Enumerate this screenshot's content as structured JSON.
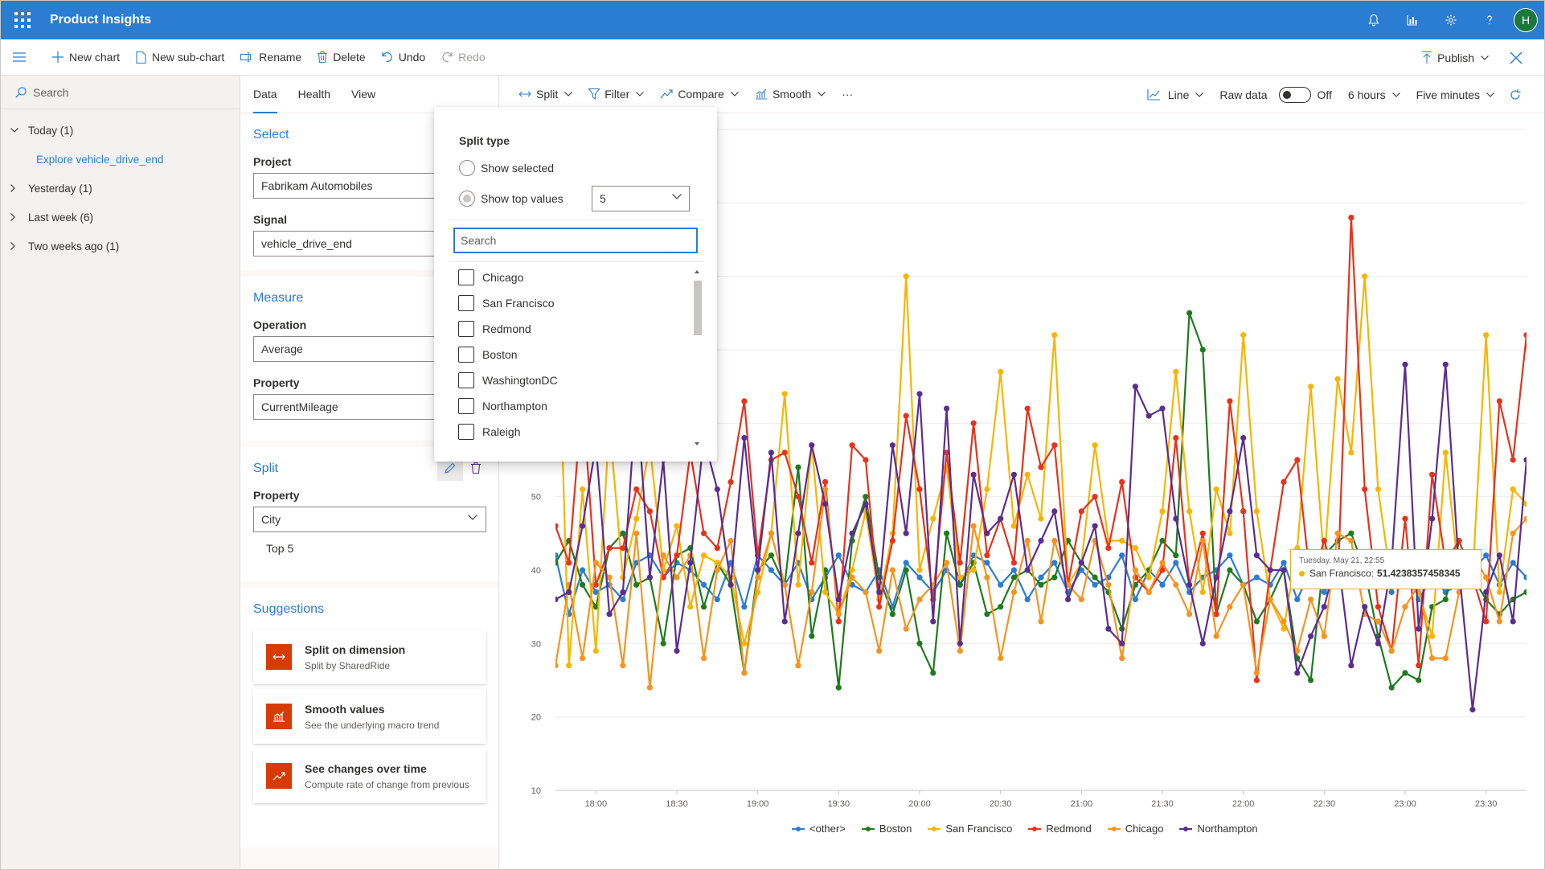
{
  "app": {
    "title": "Product Insights",
    "avatar": "H"
  },
  "topbar_icons": [
    "bell-icon",
    "chart-icon",
    "gear-icon",
    "help-icon"
  ],
  "commandbar": {
    "new_chart": "New chart",
    "new_subchart": "New sub-chart",
    "rename": "Rename",
    "delete": "Delete",
    "undo": "Undo",
    "redo": "Redo",
    "publish": "Publish"
  },
  "leftnav": {
    "search_placeholder": "Search",
    "groups": [
      {
        "label": "Today (1)",
        "expanded": true,
        "items": [
          "Explore vehicle_drive_end"
        ]
      },
      {
        "label": "Yesterday (1)",
        "expanded": false
      },
      {
        "label": "Last week (6)",
        "expanded": false
      },
      {
        "label": "Two weeks ago (1)",
        "expanded": false
      }
    ]
  },
  "config": {
    "tabs": [
      "Data",
      "Health",
      "View"
    ],
    "active_tab": "Data",
    "select": {
      "title": "Select",
      "project_label": "Project",
      "project_value": "Fabrikam Automobiles",
      "signal_label": "Signal",
      "signal_value": "vehicle_drive_end"
    },
    "measure": {
      "title": "Measure",
      "operation_label": "Operation",
      "operation_value": "Average",
      "property_label": "Property",
      "property_value": "CurrentMileage"
    },
    "split": {
      "title": "Split",
      "property_label": "Property",
      "property_value": "City",
      "note": "Top 5"
    },
    "suggestions": {
      "title": "Suggestions",
      "items": [
        {
          "title": "Split on dimension",
          "desc": "Split by SharedRide"
        },
        {
          "title": "Smooth values",
          "desc": "See the underlying macro trend"
        },
        {
          "title": "See changes over time",
          "desc": "Compute rate of change from previous"
        }
      ]
    }
  },
  "chart_toolbar": {
    "split": "Split",
    "filter": "Filter",
    "compare": "Compare",
    "smooth": "Smooth",
    "more": "···",
    "chart_type": "Line",
    "raw_data": "Raw data",
    "raw_state": "Off",
    "range": "6 hours",
    "interval": "Five minutes"
  },
  "split_popup": {
    "title": "Split type",
    "options": [
      "Show selected",
      "Show top values"
    ],
    "selected_option": "Show top values",
    "top_n": "5",
    "search_placeholder": "Search",
    "cities": [
      "Chicago",
      "San Francisco",
      "Redmond",
      "Boston",
      "WashingtonDC",
      "Northampton",
      "Raleigh"
    ]
  },
  "tooltip": {
    "date": "Tuesday, May 21, 22:55",
    "series": "San Francisco:",
    "value": "51.4238357458345"
  },
  "colors": {
    "accent": "#2b7cd3",
    "suggestion": "#d83b01",
    "other": "#2b7cd3",
    "boston": "#1e7b1e",
    "sanfrancisco": "#f7b500",
    "redmond": "#e8321b",
    "chicago": "#f7931e",
    "northampton": "#5c2d91"
  },
  "chart_data": {
    "type": "line",
    "ylim": [
      10,
      100
    ],
    "yticks": [
      "10",
      "20",
      "30",
      "40",
      "50",
      "60",
      "70",
      "80"
    ],
    "xticks": [
      "18:00",
      "18:30",
      "19:00",
      "19:30",
      "20:00",
      "20:30",
      "21:00",
      "21:30",
      "22:00",
      "22:30",
      "23:00",
      "23:30"
    ],
    "xrange_minutes": [
      1065,
      1425
    ],
    "step_minutes": 5,
    "series": [
      {
        "name": "<other>",
        "color": "#2b7cd3",
        "values": [
          42,
          34,
          40,
          37,
          38,
          36,
          41,
          42,
          39,
          41,
          40,
          38,
          36,
          41,
          35,
          42,
          40,
          38,
          41,
          36,
          39,
          42,
          38,
          37,
          40,
          35,
          41,
          39,
          37,
          40,
          38,
          42,
          41,
          38,
          40,
          36,
          39,
          41,
          37,
          40,
          38,
          39,
          42,
          36,
          40,
          38,
          41,
          37,
          39,
          40,
          42,
          38,
          39,
          38,
          41,
          36,
          40,
          37,
          39,
          38,
          40,
          41,
          37,
          42,
          36,
          39,
          37,
          38,
          40,
          42,
          38,
          41,
          39,
          40,
          43
        ]
      },
      {
        "name": "Boston",
        "color": "#1e7b1e",
        "values": [
          41,
          44,
          38,
          35,
          43,
          45,
          38,
          39,
          30,
          42,
          43,
          35,
          41,
          38,
          26,
          40,
          42,
          38,
          54,
          31,
          40,
          24,
          44,
          50,
          39,
          34,
          40,
          30,
          26,
          45,
          38,
          41,
          34,
          35,
          39,
          40,
          38,
          39,
          44,
          41,
          39,
          37,
          32,
          38,
          40,
          44,
          42,
          75,
          70,
          34,
          40,
          38,
          33,
          36,
          40,
          28,
          25,
          42,
          44,
          45,
          40,
          31,
          24,
          26,
          25,
          35,
          36,
          44,
          39,
          36,
          34,
          36,
          37,
          27,
          94
        ]
      },
      {
        "name": "San Francisco",
        "color": "#f7b500",
        "values": [
          88,
          27,
          51,
          29,
          60,
          39,
          47,
          57,
          40,
          46,
          35,
          42,
          41,
          39,
          30,
          37,
          45,
          64,
          38,
          57,
          37,
          34,
          40,
          48,
          36,
          45,
          80,
          40,
          47,
          54,
          39,
          40,
          51,
          67,
          46,
          53,
          47,
          72,
          38,
          41,
          57,
          44,
          44,
          43,
          39,
          48,
          67,
          48,
          37,
          51,
          45,
          72,
          48,
          36,
          32,
          43,
          65,
          41,
          66,
          56,
          80,
          51,
          38,
          38,
          37,
          31,
          56,
          39,
          39,
          72,
          37,
          51,
          49,
          61,
          40
        ]
      },
      {
        "name": "Redmond",
        "color": "#e8321b",
        "values": [
          46,
          41,
          64,
          38,
          43,
          43,
          51,
          48,
          39,
          42,
          56,
          45,
          43,
          52,
          63,
          42,
          55,
          56,
          50,
          41,
          52,
          33,
          57,
          55,
          35,
          44,
          61,
          51,
          36,
          56,
          41,
          60,
          42,
          47,
          41,
          62,
          54,
          57,
          38,
          48,
          50,
          43,
          52,
          39,
          37,
          40,
          58,
          38,
          45,
          34,
          63,
          48,
          25,
          40,
          52,
          55,
          38,
          44,
          38,
          88,
          51,
          35,
          29,
          47,
          27,
          53,
          41,
          44,
          39,
          33,
          63,
          55,
          72,
          29,
          38
        ]
      },
      {
        "name": "Chicago",
        "color": "#f7931e",
        "values": [
          27,
          38,
          28,
          41,
          39,
          27,
          45,
          24,
          42,
          39,
          42,
          28,
          40,
          44,
          26,
          39,
          45,
          38,
          27,
          37,
          51,
          34,
          39,
          37,
          29,
          40,
          32,
          36,
          38,
          41,
          29,
          46,
          39,
          28,
          37,
          44,
          33,
          44,
          38,
          36,
          44,
          38,
          28,
          40,
          37,
          41,
          38,
          34,
          44,
          31,
          35,
          38,
          26,
          36,
          33,
          29,
          36,
          31,
          45,
          44,
          34,
          33,
          29,
          35,
          38,
          28,
          28,
          37,
          42,
          39,
          33,
          45,
          47,
          28,
          43
        ]
      },
      {
        "name": "Northampton",
        "color": "#5c2d91",
        "values": [
          36,
          37,
          46,
          57,
          34,
          37,
          64,
          39,
          55,
          29,
          41,
          58,
          51,
          38,
          58,
          40,
          56,
          33,
          45,
          57,
          49,
          36,
          45,
          49,
          37,
          57,
          45,
          64,
          33,
          62,
          30,
          53,
          45,
          47,
          53,
          40,
          44,
          48,
          36,
          41,
          46,
          32,
          30,
          65,
          61,
          62,
          47,
          38,
          30,
          39,
          48,
          58,
          42,
          40,
          40,
          26,
          31,
          35,
          42,
          27,
          35,
          30,
          41,
          68,
          32,
          47,
          68,
          40,
          21,
          37,
          42,
          33,
          55,
          22,
          35
        ]
      }
    ]
  }
}
